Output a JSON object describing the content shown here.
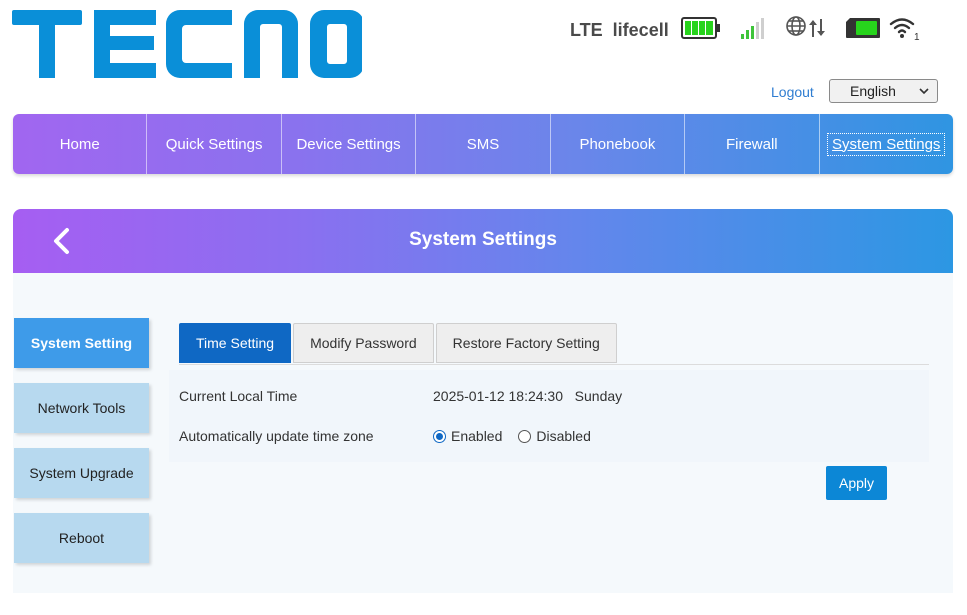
{
  "brand": {
    "logo_text": "TECNO",
    "color": "#0a8fd8"
  },
  "status": {
    "network_type": "LTE",
    "operator": "lifecell",
    "icons": [
      "battery-icon",
      "signal-icon",
      "globe-icon",
      "data-transfer-icon",
      "sim-card-icon",
      "wifi-icon"
    ],
    "wifi_clients": "1"
  },
  "header": {
    "logout_label": "Logout",
    "language": {
      "selected": "English"
    }
  },
  "nav": {
    "items": [
      {
        "label": "Home"
      },
      {
        "label": "Quick Settings"
      },
      {
        "label": "Device Settings"
      },
      {
        "label": "SMS"
      },
      {
        "label": "Phonebook"
      },
      {
        "label": "Firewall"
      },
      {
        "label": "System Settings"
      }
    ]
  },
  "page": {
    "title": "System Settings"
  },
  "side_menu": {
    "items": [
      {
        "label": "System Setting"
      },
      {
        "label": "Network Tools"
      },
      {
        "label": "System Upgrade"
      },
      {
        "label": "Reboot"
      }
    ]
  },
  "tabs": {
    "items": [
      {
        "label": "Time Setting"
      },
      {
        "label": "Modify Password"
      },
      {
        "label": "Restore Factory Setting"
      }
    ]
  },
  "time_setting": {
    "current_time_label": "Current Local Time",
    "current_time_value": "2025-01-12 18:24:30",
    "current_day": "Sunday",
    "auto_update_label": "Automatically update time zone",
    "option_enabled": "Enabled",
    "option_disabled": "Disabled",
    "selected": "Enabled"
  },
  "actions": {
    "apply_label": "Apply"
  },
  "colors": {
    "accent_blue": "#0f68c4",
    "nav_gradient_start": "#a166f0",
    "nav_gradient_end": "#2f95e2",
    "side_active": "#3e9be9",
    "side_inactive": "#b7d9ef",
    "battery_green": "#27d41c"
  }
}
